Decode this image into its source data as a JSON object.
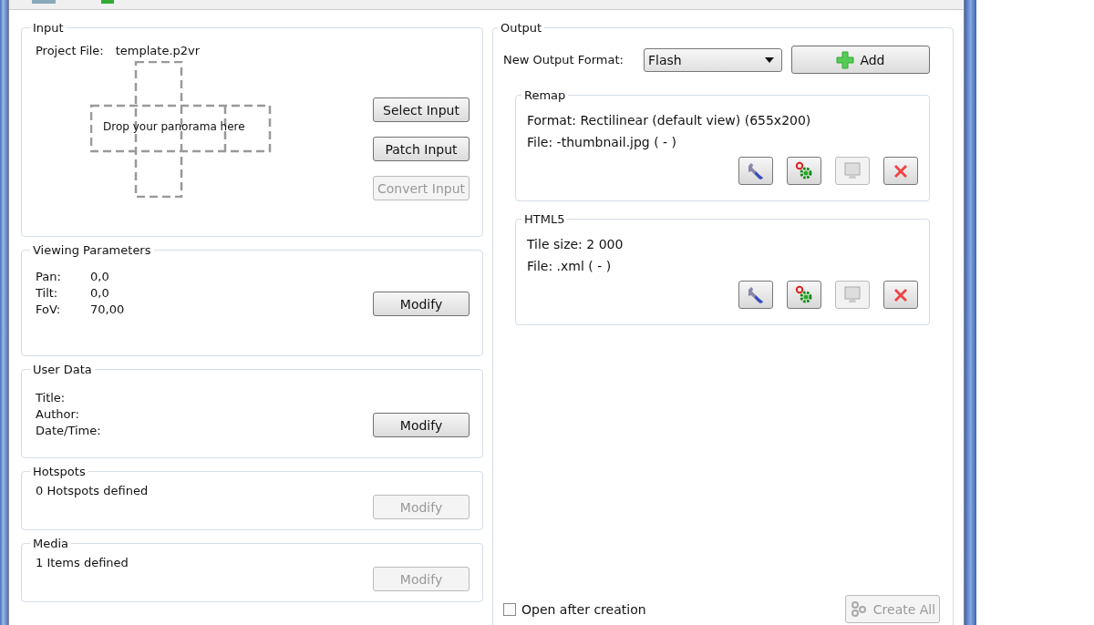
{
  "input": {
    "legend": "Input",
    "project_label": "Project File:",
    "project_file": "template.p2vr",
    "drop_hint": "Drop your panorama here",
    "buttons": [
      {
        "label": "Select Input",
        "disabled": false
      },
      {
        "label": "Patch Input",
        "disabled": false
      },
      {
        "label": "Convert Input",
        "disabled": true
      }
    ]
  },
  "viewing": {
    "legend": "Viewing Parameters",
    "params": [
      {
        "label": "Pan:",
        "value": "0,0"
      },
      {
        "label": "Tilt:",
        "value": "0,0"
      },
      {
        "label": "FoV:",
        "value": "70,00"
      }
    ],
    "button": {
      "label": "Modify",
      "disabled": false
    }
  },
  "user_data": {
    "legend": "User Data",
    "fields": [
      "Title:",
      "Author:",
      "Date/Time:"
    ],
    "button": {
      "label": "Modify",
      "disabled": false
    }
  },
  "hotspots": {
    "legend": "Hotspots",
    "summary": "0 Hotspots defined",
    "button": {
      "label": "Modify",
      "disabled": true
    }
  },
  "media": {
    "legend": "Media",
    "summary": "1 Items defined",
    "button": {
      "label": "Modify",
      "disabled": true
    }
  },
  "output": {
    "legend": "Output",
    "format_label": "New Output Format:",
    "format_value": "Flash",
    "add_button": "Add",
    "outputs": [
      {
        "title": "Remap",
        "lines": [
          "Format: Rectilinear (default view) (655x200)",
          "File: -thumbnail.jpg ( - )"
        ],
        "actions": [
          {
            "kind": "edit",
            "disabled": false
          },
          {
            "kind": "generate",
            "disabled": false
          },
          {
            "kind": "preview",
            "disabled": true
          },
          {
            "kind": "delete",
            "disabled": false
          }
        ]
      },
      {
        "title": "HTML5",
        "lines": [
          "Tile size: 2 000",
          "File: .xml ( - )"
        ],
        "actions": [
          {
            "kind": "edit",
            "disabled": false
          },
          {
            "kind": "generate",
            "disabled": false
          },
          {
            "kind": "preview",
            "disabled": true
          },
          {
            "kind": "delete",
            "disabled": false
          }
        ]
      }
    ],
    "open_after_creation": {
      "label": "Open after creation",
      "checked": false
    },
    "create_all": {
      "label": "Create All",
      "disabled": true
    }
  }
}
